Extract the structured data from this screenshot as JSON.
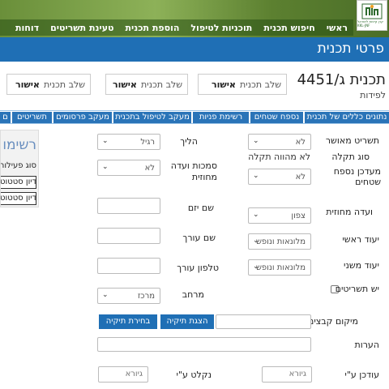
{
  "header": {
    "logo_text": "קרן קיימת לישראל KKL-JNF",
    "nav": [
      "ראשי",
      "חיפוש תכנית",
      "תוכניות לטיפול",
      "הוספת תכנית",
      "טעינת תשריטים",
      "דוחות"
    ]
  },
  "page_title": "פרטי תכנית",
  "summary": {
    "plan_number": "תכנית ג/4451",
    "plan_sub": "לפידות",
    "stages": [
      {
        "label": "שלב תכנית",
        "value": "אישור"
      },
      {
        "label": "שלב תכנית",
        "value": "אישור"
      },
      {
        "label": "שלב תכנית",
        "value": "אישור"
      }
    ]
  },
  "tabs": [
    "נתונים כללים של תכנית",
    "נספח שטחים",
    "רשימת פניות",
    "מעקב לטיפול בתכנית",
    "מעקב פרסומים",
    "תשריטים",
    "ם"
  ],
  "form": {
    "approved_plan_label": "תשריט מאושר",
    "approved_plan_value": "לא",
    "approval_type_label": "סוג תקלה",
    "approval_type_value": "לא מהווה תקלה",
    "updated_annex_label": "מעדכן נספח שטחים",
    "updated_annex_value": "לא",
    "district_committee_label": "ועדה מחוזית",
    "district_committee_value": "צפון",
    "main_use_label": "יעוד ראשי",
    "main_use_value": "מלונאות ונופש",
    "secondary_use_label": "יעוד משני",
    "secondary_use_value": "מלונאות ונופש",
    "has_drawings_label": "יש תשריטים",
    "route_label": "הליך",
    "route_value": "רגיל",
    "authority_label": "סמכות ועדה מחוזית",
    "authority_value": "לא",
    "initiator_label": "שם יזם",
    "editor_label": "שם עורך",
    "editor_phone_label": "טלפון עורך",
    "region_label": "מרחב",
    "region_value": "מרכז",
    "files_label": "מיקום קבצים",
    "show_tag_button": "הצגת תיקיה",
    "choose_tag_button": "בחירת תיקיה",
    "notes_label": "הערות",
    "updated_by_label": "עודכן ע\"י",
    "updated_by_placeholder": "גיורא",
    "taken_by_label": "נקלט ע\"י",
    "taken_by_placeholder": "גיורא"
  },
  "side_panel": {
    "title": "רשימו",
    "subtitle": "סוג פעילות",
    "buttons": [
      "דיון סטטוט",
      "דיון סטטוט"
    ]
  }
}
